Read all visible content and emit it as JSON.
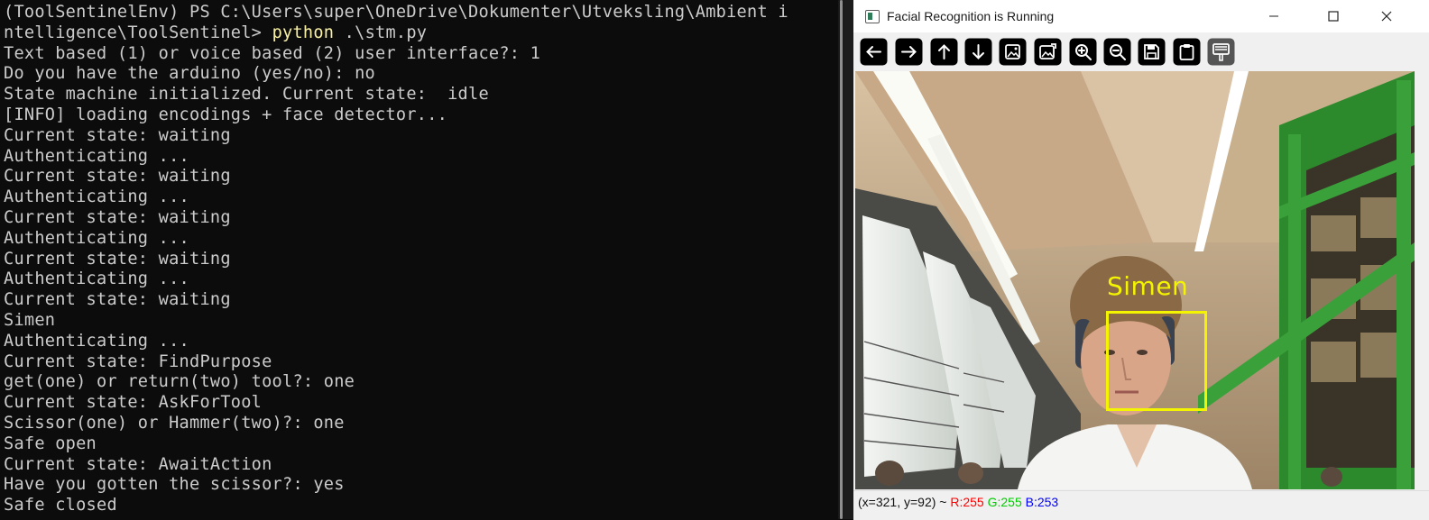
{
  "terminal": {
    "prompt_line_1": "(ToolSentinelEnv) PS C:\\Users\\super\\OneDrive\\Dokumenter\\Utveksling\\Ambient i",
    "prompt_line_2": "ntelligence\\ToolSentinel> ",
    "command": "python",
    "command_args": " .\\stm.py",
    "lines": [
      "Text based (1) or voice based (2) user interface?: 1",
      "Do you have the arduino (yes/no): no",
      "State machine initialized. Current state:  idle",
      "[INFO] loading encodings + face detector...",
      "Current state: waiting",
      "Authenticating ...",
      "Current state: waiting",
      "Authenticating ...",
      "Current state: waiting",
      "Authenticating ...",
      "Current state: waiting",
      "Authenticating ...",
      "Current state: waiting",
      "Simen",
      "Authenticating ...",
      "Current state: FindPurpose",
      "get(one) or return(two) tool?: one",
      "Current state: AskForTool",
      "Scissor(one) or Hammer(two)?: one",
      "Safe open",
      "Current state: AwaitAction",
      "Have you gotten the scissor?: yes",
      "Safe closed"
    ]
  },
  "viewer": {
    "title": "Facial Recognition is Running",
    "toolbar_icons": [
      "arrow-left-icon",
      "arrow-right-icon",
      "arrow-up-icon",
      "arrow-down-icon",
      "image-icon",
      "image-edit-icon",
      "zoom-in-icon",
      "zoom-out-icon",
      "save-icon",
      "clipboard-icon",
      "properties-icon"
    ],
    "face_label": "Simen",
    "face_box_color": "#f4f400",
    "status": {
      "coords": "(x=321, y=92) ~ ",
      "r": "R:255",
      "g": " G:255",
      "b": " B:253"
    }
  },
  "colors": {
    "terminal_bg": "#0c0c0c",
    "terminal_text": "#cccccc",
    "command_highlight": "#f9f1a5"
  }
}
